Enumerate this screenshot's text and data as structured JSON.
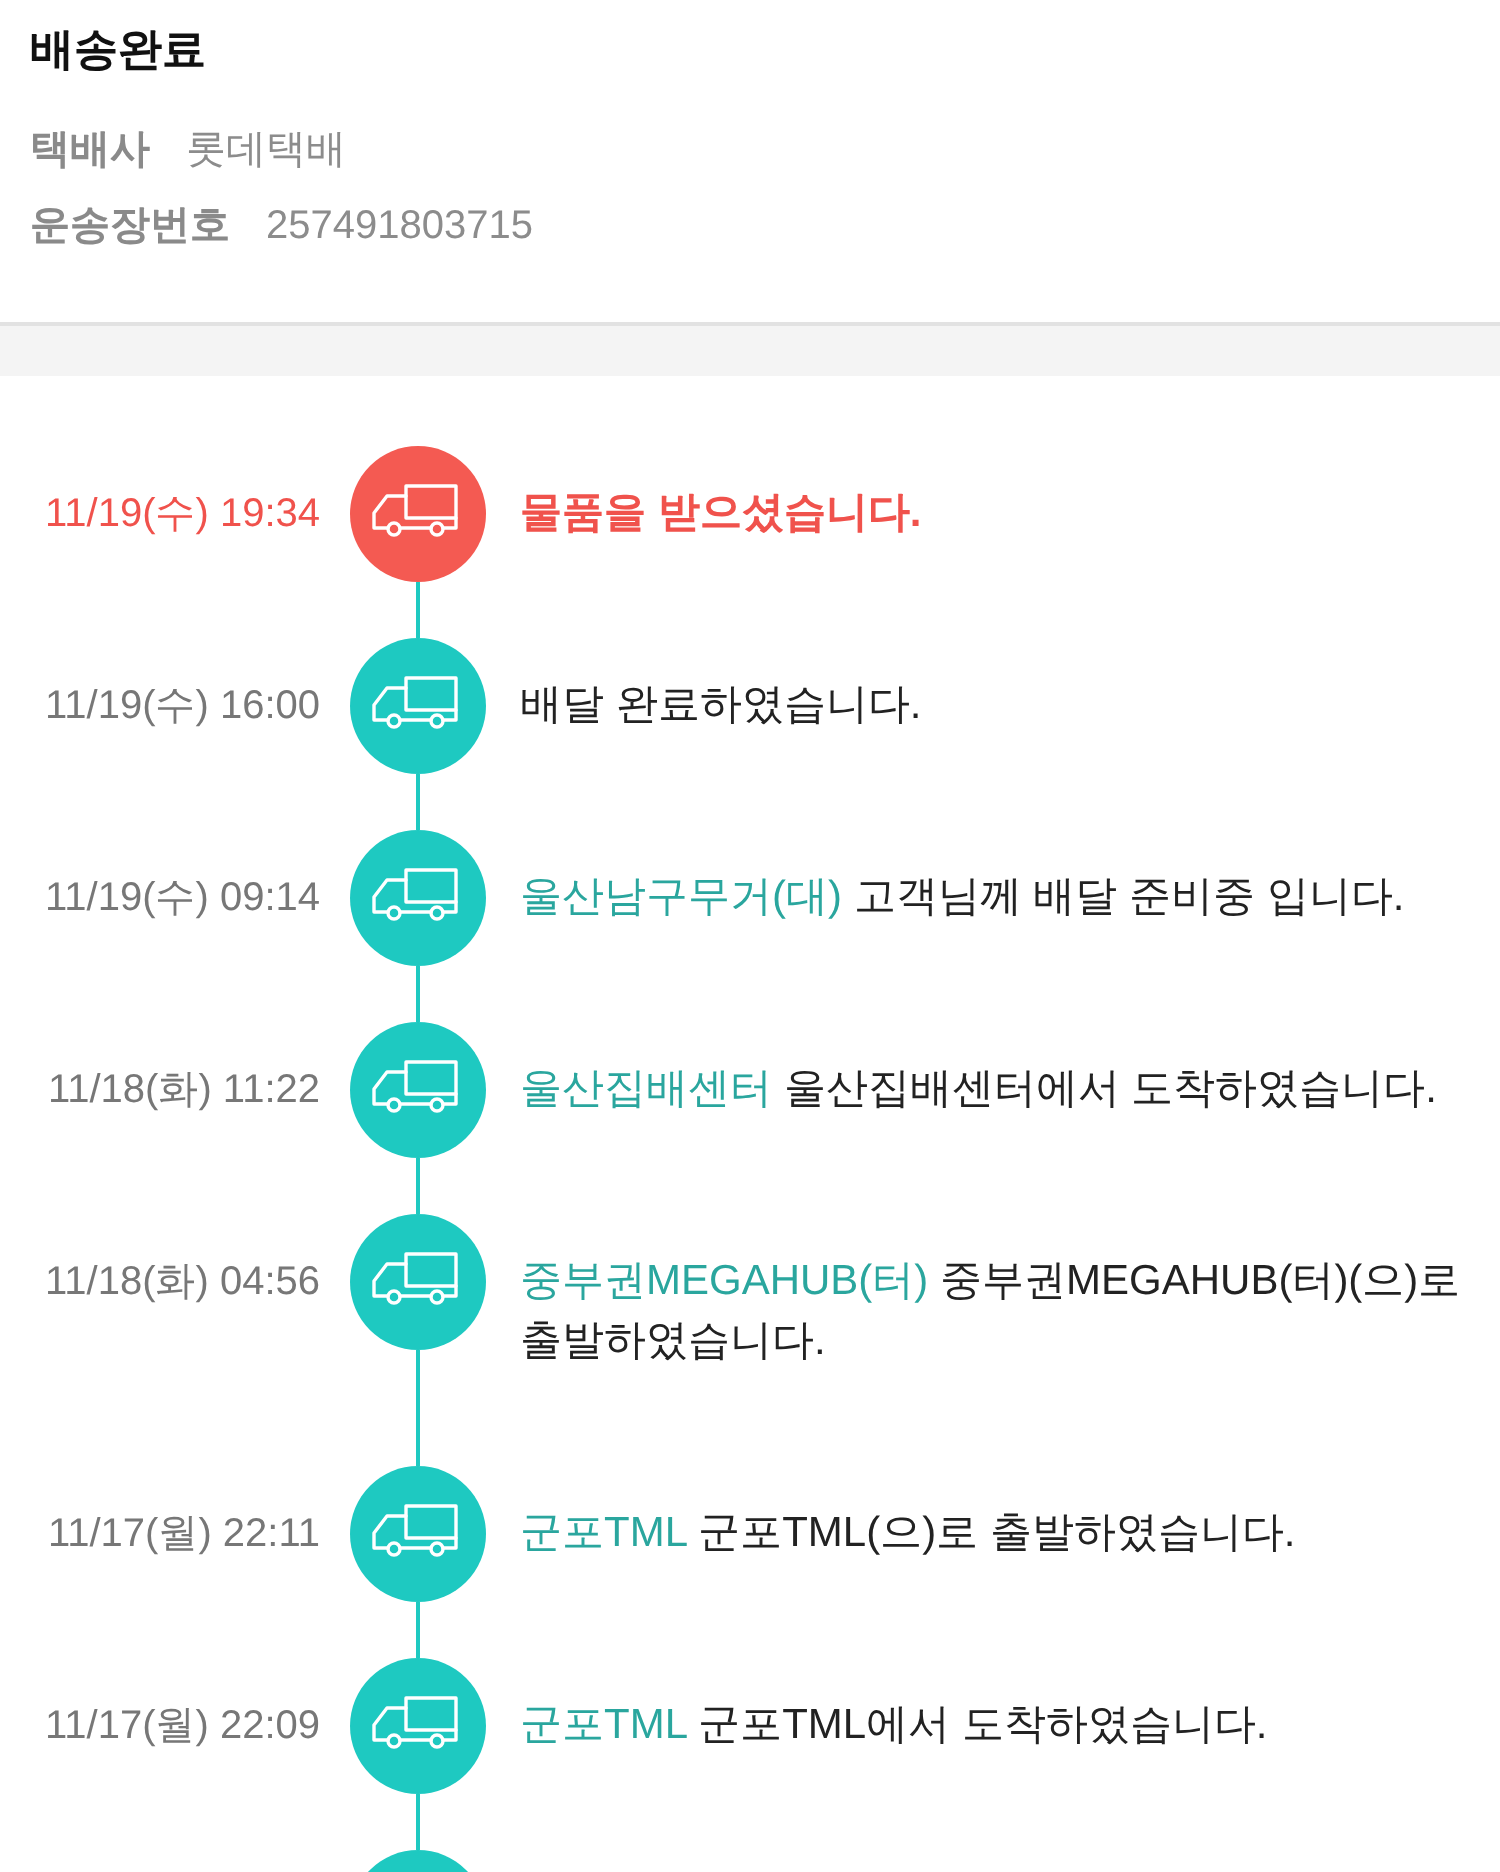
{
  "header": {
    "title": "배송완료",
    "fields": [
      {
        "label": "택배사",
        "value": "롯데택배"
      },
      {
        "label": "운송장번호",
        "value": "257491803715"
      }
    ]
  },
  "tracking_events": [
    {
      "time": "11/19(수) 19:34",
      "message": "물품을 받으셨습니다.",
      "current": true
    },
    {
      "time": "11/19(수) 16:00",
      "message": "배달 완료하였습니다.",
      "current": false
    },
    {
      "time": "11/19(수) 09:14",
      "location": "울산남구무거(대)",
      "message": "고객님께 배달 준비중 입니다.",
      "current": false
    },
    {
      "time": "11/18(화) 11:22",
      "location": "울산집배센터",
      "message": "울산집배센터에서 도착하였습니다.",
      "current": false
    },
    {
      "time": "11/18(화) 04:56",
      "location": "중부권MEGAHUB(터)",
      "message": "중부권MEGAHUB(터)(으)로 출발하였습니다.",
      "current": false
    },
    {
      "time": "11/17(월) 22:11",
      "location": "군포TML",
      "message": "군포TML(으)로 출발하였습니다.",
      "current": false
    },
    {
      "time": "11/17(월) 22:09",
      "location": "군포TML",
      "message": "군포TML에서 도착하였습니다.",
      "current": false
    },
    {
      "current": false
    }
  ]
}
